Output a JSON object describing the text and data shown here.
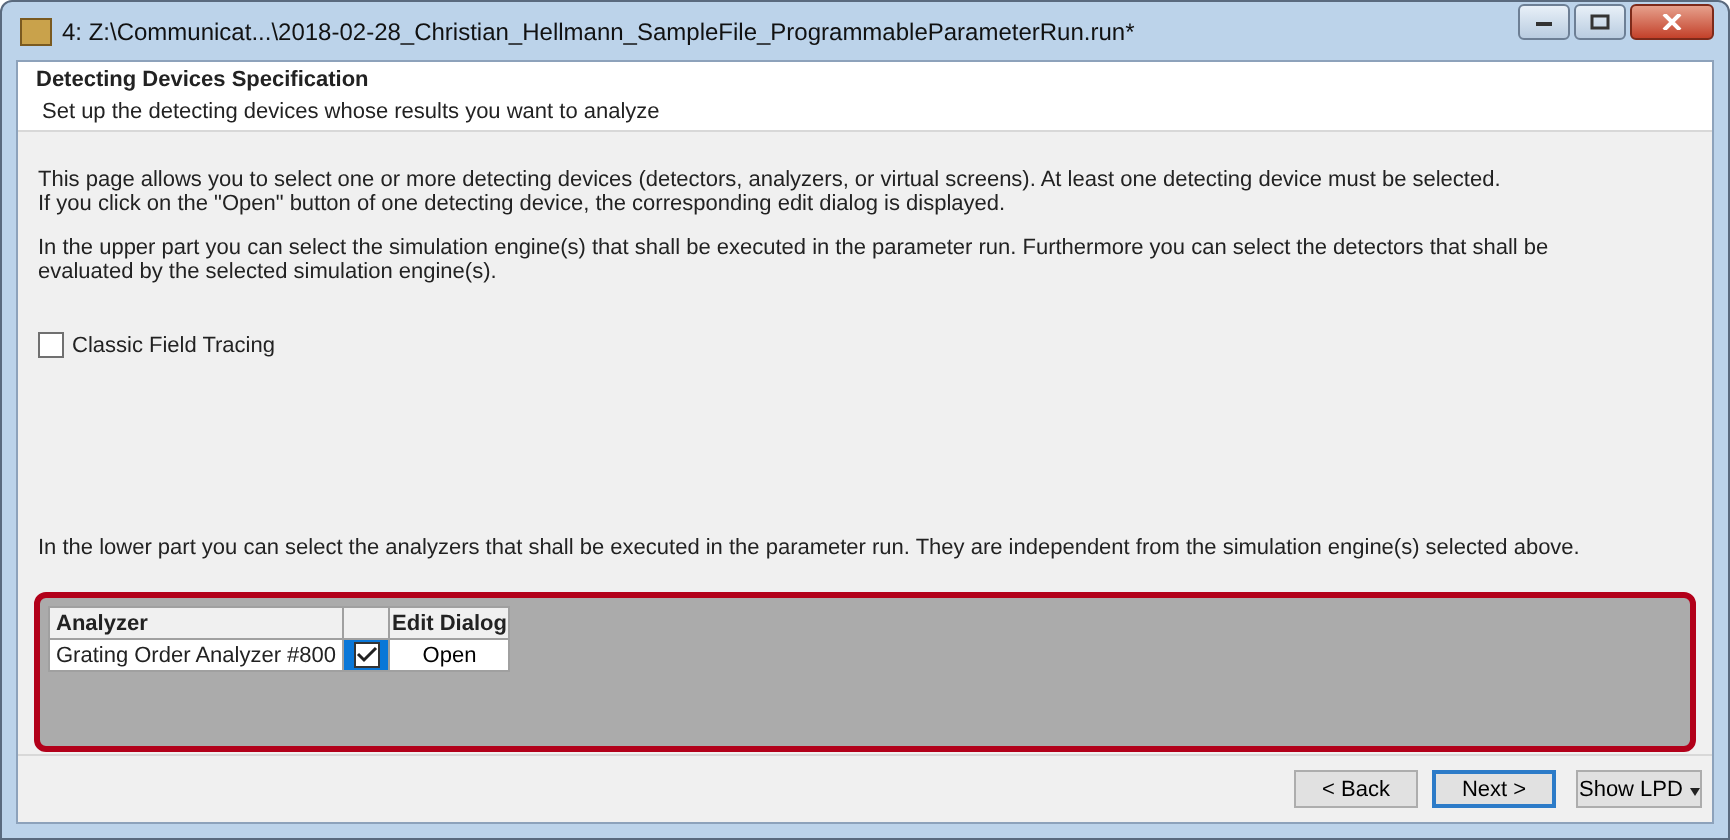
{
  "window": {
    "title": "4: Z:\\Communicat...\\2018-02-28_Christian_Hellmann_SampleFile_ProgrammableParameterRun.run*"
  },
  "header": {
    "title": "Detecting Devices Specification",
    "subtitle": "Set up the detecting devices whose results you want to analyze"
  },
  "intro": [
    "This page allows you to select one or more detecting devices (detectors, analyzers, or virtual screens). At least one detecting device must be selected.",
    "If you click on the \"Open\" button of one detecting device, the corresponding edit dialog is displayed."
  ],
  "upper_text": "In the upper part you can select the simulation engine(s) that shall be executed in the parameter run. Furthermore you can select the detectors that shall be evaluated by the selected simulation engine(s).",
  "engines": [
    {
      "label": "Classic Field Tracing",
      "checked": false
    }
  ],
  "lower_text": "In the lower part you can select the analyzers that shall be executed in the parameter run. They are independent from the simulation engine(s) selected above.",
  "table": {
    "columns": [
      "Analyzer",
      "Edit Dialog"
    ],
    "rows": [
      {
        "name": "Grating Order Analyzer #800",
        "checked": true,
        "button": "Open"
      }
    ]
  },
  "buttons": [
    {
      "label": "< Back",
      "kind": "plain"
    },
    {
      "label": "Next >",
      "kind": "default"
    },
    {
      "label": "Show  LPD",
      "kind": "dropdown"
    }
  ]
}
